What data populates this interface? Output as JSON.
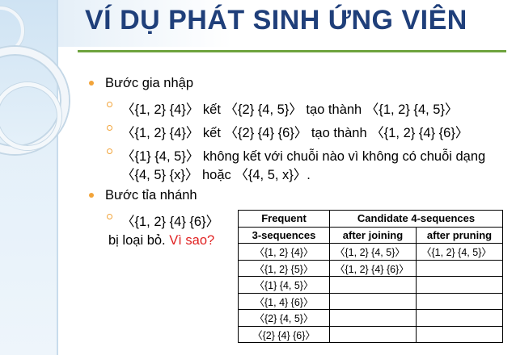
{
  "slide": {
    "title": "VÍ DỤ PHÁT SINH ỨNG VIÊN",
    "bullets": {
      "b1": "Bước gia nhập",
      "b1_sub1": "〈{1, 2} {4}〉 kết 〈{2} {4, 5}〉 tạo thành 〈{1, 2} {4, 5}〉",
      "b1_sub2": "〈{1, 2} {4}〉 kết 〈{2} {4} {6}〉 tạo thành 〈{1, 2} {4} {6}〉",
      "b1_sub3_line1": "〈{1} {4, 5}〉 không kết với chuỗi nào vì không có chuỗi dạng",
      "b1_sub3_line2": "〈{4, 5} {x}〉 hoặc 〈{4, 5, x}〉.",
      "b2": "Bước tỉa nhánh",
      "b2_sub1": "〈{1, 2} {4} {6}〉",
      "b2_note_prefix": "bị loại bỏ.",
      "b2_note_red": "Vì sao?"
    },
    "table": {
      "header_col1_line1": "Frequent",
      "header_col1_line2": "3-sequences",
      "header_group": "Candidate 4-sequences",
      "header_col2": "after joining",
      "header_col3": "after pruning",
      "rows": [
        [
          "〈{1, 2} {4}〉",
          "〈{1, 2} {4, 5}〉",
          "〈{1, 2} {4, 5}〉"
        ],
        [
          "〈{1, 2} {5}〉",
          "〈{1, 2} {4} {6}〉",
          ""
        ],
        [
          "〈{1} {4, 5}〉",
          "",
          ""
        ],
        [
          "〈{1, 4} {6}〉",
          "",
          ""
        ],
        [
          "〈{2} {4, 5}〉",
          "",
          ""
        ],
        [
          "〈{2} {4} {6}〉",
          "",
          ""
        ]
      ]
    },
    "colors": {
      "title": "#1f3f7a",
      "rule": "#6ea33e",
      "bullet": "#f2a43a",
      "emphasis": "#e02020"
    }
  }
}
